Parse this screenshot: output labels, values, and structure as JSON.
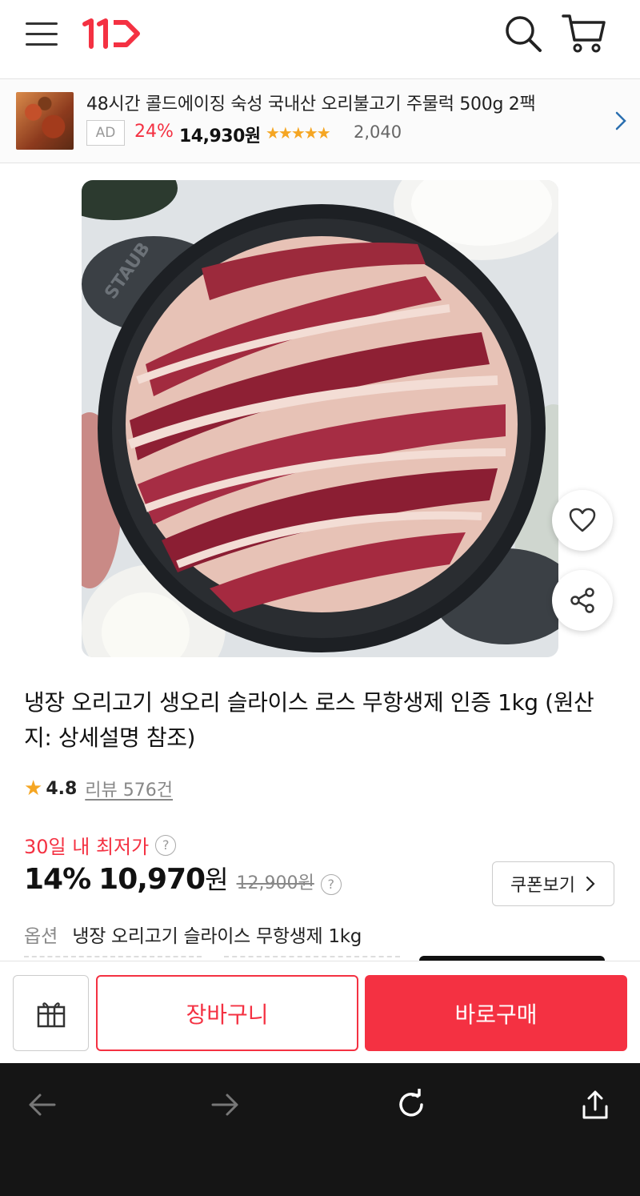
{
  "header": {
    "logo_text": "11",
    "icons": [
      "menu-icon",
      "search-icon",
      "cart-icon"
    ]
  },
  "ad": {
    "title": "48시간 콜드에이징 숙성 국내산 오리불고기 주물럭 500g 2팩",
    "badge": "AD",
    "discount": "24%",
    "price": "14,930원",
    "stars": "★★★★★",
    "rating_value": 4.5,
    "review_count": "2,040"
  },
  "product": {
    "title": "냉장 오리고기 생오리 슬라이스 로스 무항생제 인증 1kg (원산지: 상세설명 참조)",
    "rating": "4.8",
    "review_link": "리뷰 576건",
    "lowest_label": "30일 내 최저가",
    "help": "?",
    "discount": "14%",
    "sale_price": "10,970",
    "won": "원",
    "original_price": "12,900원",
    "coupon_label": "쿠폰보기",
    "option_label": "옵션",
    "option_value": "냉장 오리고기 슬라이스 무항생제 1kg"
  },
  "actions": {
    "cart_label": "장바구니",
    "buy_label": "바로구매"
  },
  "colors": {
    "accent": "#f43142",
    "star": "#f5a623",
    "browser_bg": "#151515"
  }
}
